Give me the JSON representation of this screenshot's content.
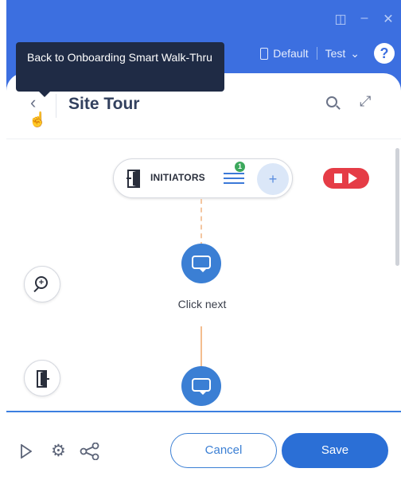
{
  "window": {
    "controls": {
      "panel_icon": "panel-toggle-icon",
      "minimize_icon": "minimize-icon",
      "close_icon": "close-icon"
    },
    "environment": {
      "label": "Default",
      "icon": "phone-icon"
    },
    "mode": {
      "label": "Test",
      "icon": "chevron-down-icon"
    },
    "help_label": "?"
  },
  "tooltip": {
    "text": "Back to Onboarding Smart Walk-Thru"
  },
  "header": {
    "title": "Site Tour",
    "back_icon": "chevron-left-icon",
    "search_icon": "search-icon",
    "expand_icon": "expand-icon"
  },
  "flow": {
    "initiators_label": "INITIATORS",
    "initiator_count": "1",
    "add_label": "+",
    "steps": [
      {
        "label": "Click next",
        "icon": "message-bubble-icon"
      },
      {
        "label": "",
        "icon": "message-bubble-icon"
      }
    ]
  },
  "tools": {
    "zoom_icon": "zoom-in-icon",
    "exit_icon": "exit-door-icon"
  },
  "footer": {
    "play_icon": "play-icon",
    "settings_icon": "gear-icon",
    "share_icon": "share-icon",
    "cancel_label": "Cancel",
    "save_label": "Save"
  },
  "colors": {
    "brand": "#3c6fe0",
    "accent": "#2b6fd6",
    "launcher": "#e53c46",
    "step": "#3b7fd4"
  }
}
